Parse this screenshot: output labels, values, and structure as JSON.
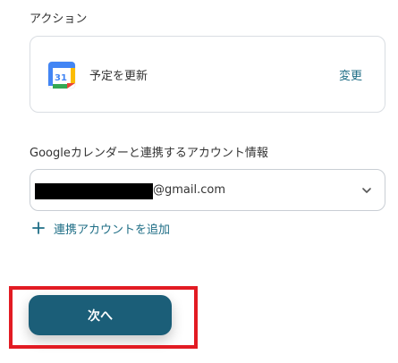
{
  "action_section": {
    "label": "アクション",
    "action_name": "予定を更新",
    "change_label": "変更",
    "icon": "google-calendar-icon",
    "icon_day": "31"
  },
  "account_section": {
    "label": "Googleカレンダーと連携するアカウント情報",
    "selected_account_domain": "@gmail.com",
    "add_account_label": "連携アカウントを追加"
  },
  "footer": {
    "next_label": "次へ"
  },
  "colors": {
    "accent": "#1f6e86",
    "button_bg": "#1b5e78",
    "highlight": "#e21b23"
  }
}
